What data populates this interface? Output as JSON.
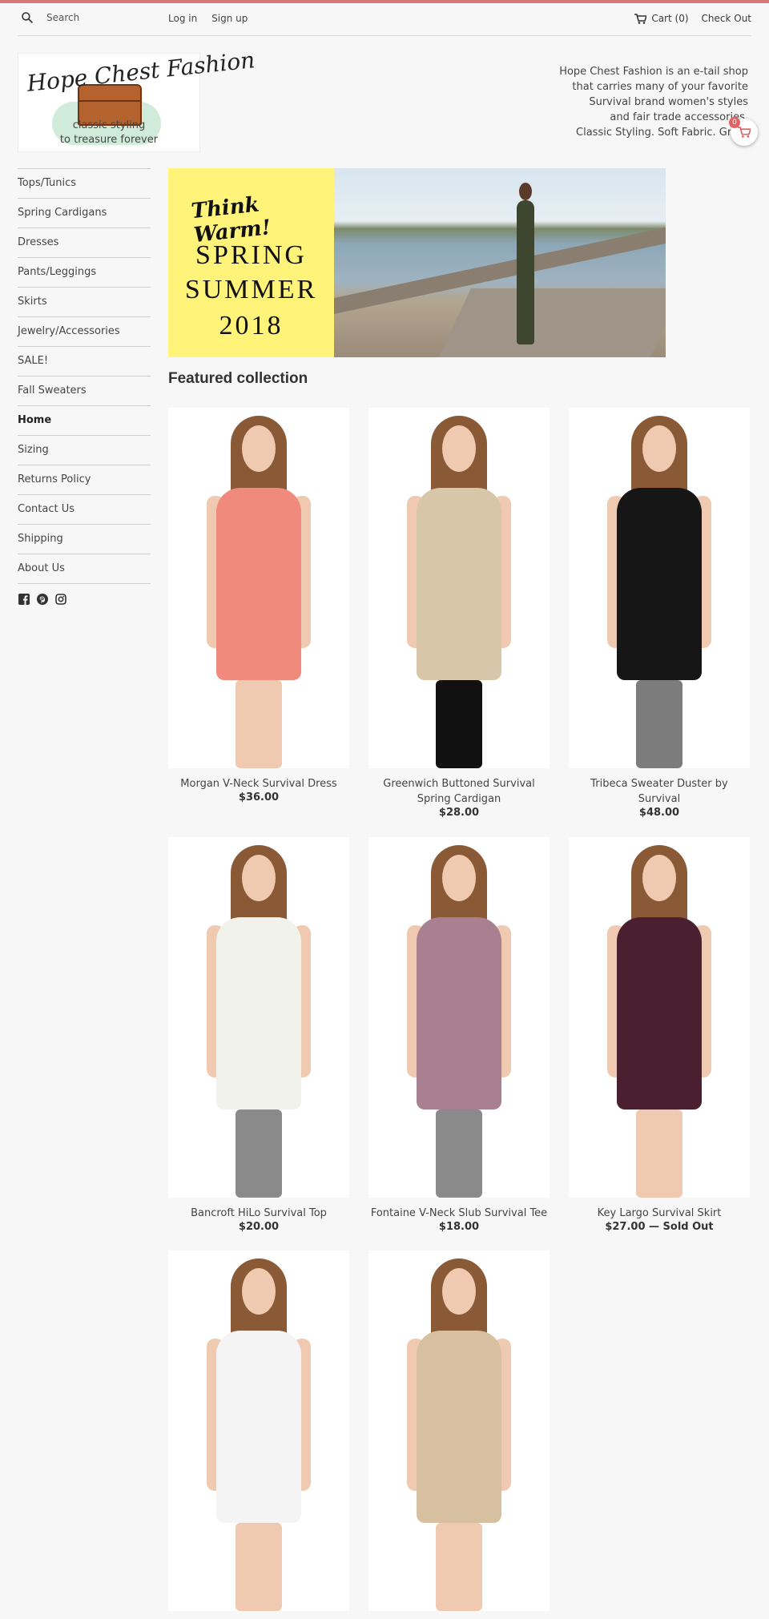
{
  "header": {
    "search_placeholder": "Search",
    "login": "Log in",
    "signup": "Sign up",
    "cart": "Cart (0)",
    "checkout": "Check Out"
  },
  "logo": {
    "title": "Hope Chest Fashion",
    "line1": "classic styling",
    "line2": "to treasure forever"
  },
  "tagline": [
    "Hope Chest Fashion is an e-tail shop",
    "that carries many of your favorite",
    "Survival brand women's styles",
    "and fair trade accessories.",
    "Classic Styling. Soft Fabric. Great"
  ],
  "cart_count": "0",
  "sidebar": {
    "items": [
      {
        "label": "Tops/Tunics"
      },
      {
        "label": "Spring Cardigans"
      },
      {
        "label": "Dresses"
      },
      {
        "label": "Pants/Leggings"
      },
      {
        "label": "Skirts"
      },
      {
        "label": "Jewelry/Accessories"
      },
      {
        "label": "SALE!"
      },
      {
        "label": "Fall Sweaters"
      },
      {
        "label": "Home"
      },
      {
        "label": "Sizing"
      },
      {
        "label": "Returns Policy"
      },
      {
        "label": "Contact Us"
      },
      {
        "label": "Shipping"
      },
      {
        "label": "About Us"
      }
    ],
    "active": "Home"
  },
  "social": [
    "facebook-icon",
    "pinterest-icon",
    "instagram-icon"
  ],
  "banner": {
    "think": "Think Warm!",
    "line1": "SPRING",
    "line2": "SUMMER",
    "line3": "2018"
  },
  "featured_title": "Featured collection",
  "products": [
    {
      "name": "Morgan V-Neck Survival Dress",
      "price": "$36.00",
      "color": "#f08a7c",
      "legs": "#efcab0"
    },
    {
      "name": "Greenwich Buttoned Survival Spring Cardigan",
      "price": "$28.00",
      "color": "#d8c6a8",
      "legs": "#111111"
    },
    {
      "name": "Tribeca Sweater Duster by Survival",
      "price": "$48.00",
      "color": "#161616",
      "legs": "#7c7c7c"
    },
    {
      "name": "Bancroft HiLo Survival Top",
      "price": "$20.00",
      "color": "#f2f2ec",
      "legs": "#8a8a8a"
    },
    {
      "name": "Fontaine V-Neck Slub Survival Tee",
      "price": "$18.00",
      "color": "#a98090",
      "legs": "#8a8a8a"
    },
    {
      "name": "Key Largo Survival Skirt",
      "price": "$27.00 — Sold Out",
      "color": "#4a2030",
      "legs": "#efcab0"
    },
    {
      "name": "",
      "price": "",
      "color": "#f4f4f4",
      "legs": "#efcab0"
    },
    {
      "name": "",
      "price": "",
      "color": "#d6c0a0",
      "legs": "#efcab0"
    }
  ]
}
